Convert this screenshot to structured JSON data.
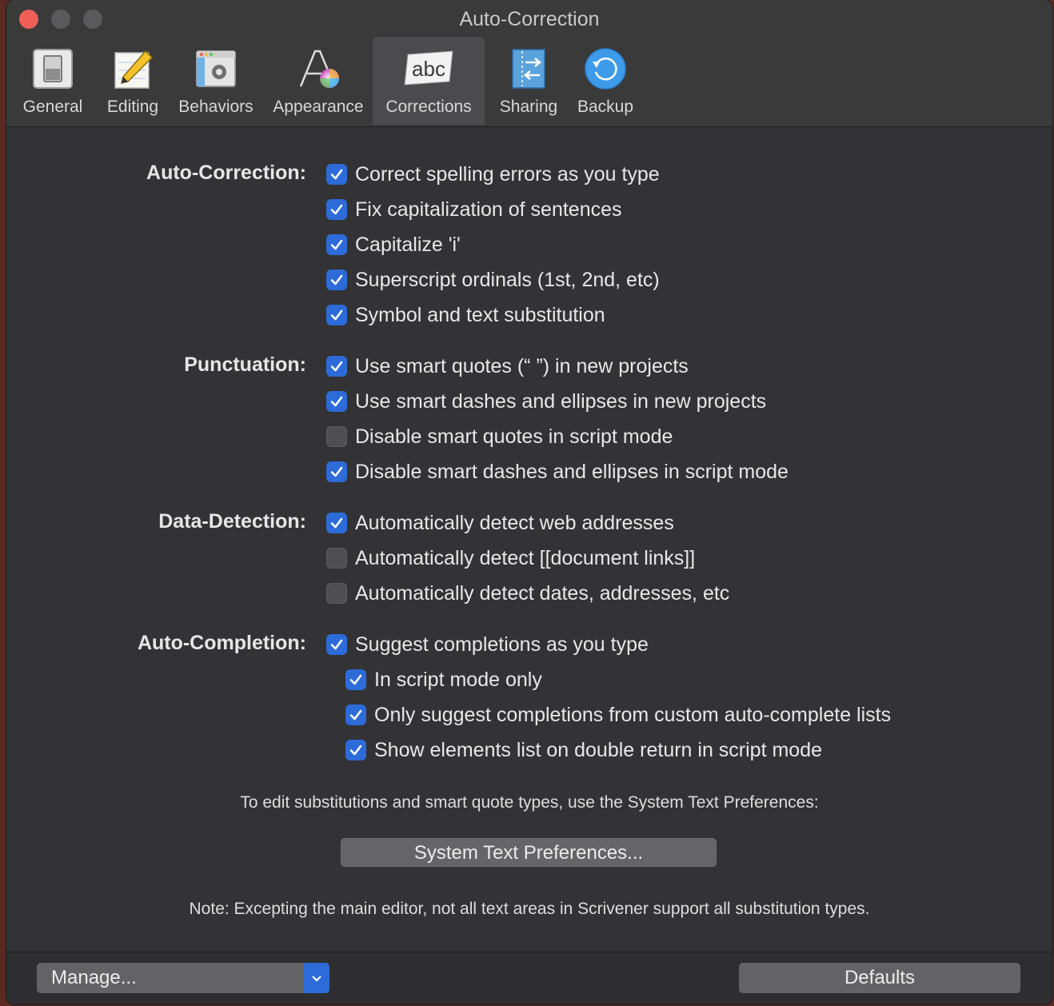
{
  "window": {
    "title": "Auto-Correction"
  },
  "toolbar": {
    "items": [
      {
        "label": "General",
        "icon": "general-switch-icon"
      },
      {
        "label": "Editing",
        "icon": "pencil-icon"
      },
      {
        "label": "Behaviors",
        "icon": "gear-window-icon"
      },
      {
        "label": "Appearance",
        "icon": "font-color-icon"
      },
      {
        "label": "Corrections",
        "icon": "abc-icon",
        "selected": true
      },
      {
        "label": "Sharing",
        "icon": "sharing-arrows-icon"
      },
      {
        "label": "Backup",
        "icon": "backup-clock-icon"
      }
    ]
  },
  "sections": {
    "auto_correction": {
      "label": "Auto-Correction:",
      "options": [
        {
          "label": "Correct spelling errors as you type",
          "checked": true
        },
        {
          "label": "Fix capitalization of sentences",
          "checked": true
        },
        {
          "label": "Capitalize 'i'",
          "checked": true
        },
        {
          "label": "Superscript ordinals (1st, 2nd, etc)",
          "checked": true
        },
        {
          "label": "Symbol and text substitution",
          "checked": true
        }
      ]
    },
    "punctuation": {
      "label": "Punctuation:",
      "options": [
        {
          "label": "Use smart quotes (“ ”) in new projects",
          "checked": true
        },
        {
          "label": "Use smart dashes and ellipses in new projects",
          "checked": true
        },
        {
          "label": "Disable smart quotes in script mode",
          "checked": false
        },
        {
          "label": "Disable smart dashes and ellipses in script mode",
          "checked": true
        }
      ]
    },
    "data_detection": {
      "label": "Data-Detection:",
      "options": [
        {
          "label": "Automatically detect web addresses",
          "checked": true
        },
        {
          "label": "Automatically detect [[document links]]",
          "checked": false
        },
        {
          "label": "Automatically detect dates, addresses, etc",
          "checked": false
        }
      ]
    },
    "auto_completion": {
      "label": "Auto-Completion:",
      "options": [
        {
          "label": "Suggest completions as you type",
          "checked": true
        },
        {
          "label": "In script mode only",
          "checked": true
        },
        {
          "label": "Only suggest completions from custom auto-complete lists",
          "checked": true
        },
        {
          "label": "Show elements list on double return in script mode",
          "checked": true
        }
      ]
    }
  },
  "info": {
    "substitutions_text": "To edit substitutions and smart quote types, use the System Text Preferences:",
    "system_button": "System Text Preferences...",
    "note": "Note: Excepting the main editor, not all text areas in Scrivener support all substitution types."
  },
  "footer": {
    "manage_label": "Manage...",
    "defaults_label": "Defaults"
  },
  "colors": {
    "accent": "#2c6bd8",
    "close": "#ed5f57",
    "background": "#333335"
  }
}
